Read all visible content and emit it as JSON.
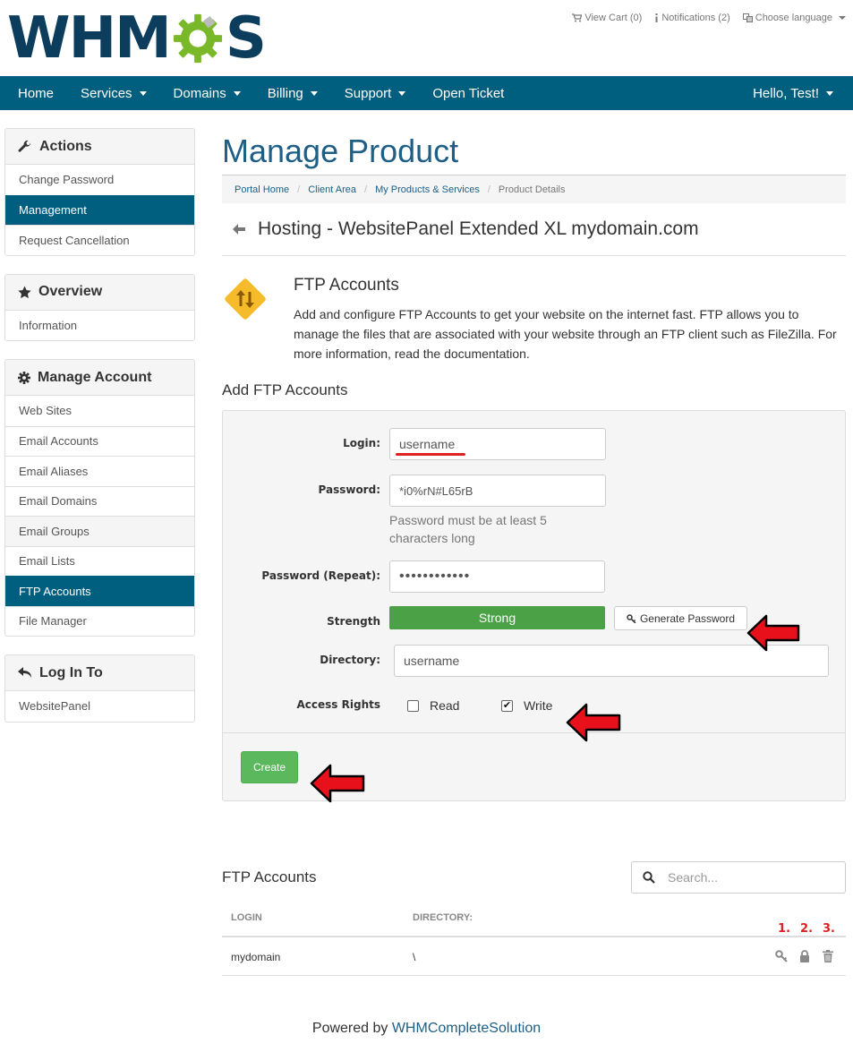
{
  "brand": {
    "logo_prefix": "WHM",
    "logo_suffix": "S"
  },
  "top_links": {
    "cart": "View Cart (0)",
    "notifications": "Notifications (2)",
    "language": "Choose language"
  },
  "nav": {
    "home": "Home",
    "services": "Services",
    "domains": "Domains",
    "billing": "Billing",
    "support": "Support",
    "open_ticket": "Open Ticket",
    "user": "Hello, Test!"
  },
  "sidebar": {
    "actions": {
      "title": "Actions",
      "items": [
        "Change Password",
        "Management",
        "Request Cancellation"
      ]
    },
    "overview": {
      "title": "Overview",
      "items": [
        "Information"
      ]
    },
    "manage": {
      "title": "Manage Account",
      "items": [
        "Web Sites",
        "Email Accounts",
        "Email Aliases",
        "Email Domains",
        "Email Groups",
        "Email Lists",
        "FTP Accounts",
        "File Manager"
      ]
    },
    "login": {
      "title": "Log In To",
      "items": [
        "WebsitePanel"
      ]
    }
  },
  "page": {
    "title": "Manage Product",
    "breadcrumb": [
      "Portal Home",
      "Client Area",
      "My Products & Services",
      "Product Details"
    ],
    "product": "Hosting - WebsitePanel Extended XL mydomain.com"
  },
  "intro": {
    "title": "FTP Accounts",
    "text": "Add and configure FTP Accounts to get your website on the internet fast. FTP allows you to manage the files that are associated with your website through an FTP client such as FileZilla. For more information, read the documentation."
  },
  "form": {
    "section_title": "Add FTP Accounts",
    "login_label": "Login:",
    "login_value": "username",
    "password_label": "Password:",
    "password_value": "*i0%rN#L65rB",
    "password_help": "Password must be at least 5 characters long",
    "repeat_label": "Password (Repeat):",
    "repeat_value": "••••••••••••",
    "strength_label": "Strength",
    "strength_value": "Strong",
    "generate_label": "Generate Password",
    "directory_label": "Directory:",
    "directory_value": "username",
    "rights_label": "Access Rights",
    "read_label": "Read",
    "read_checked": false,
    "write_label": "Write",
    "write_checked": true,
    "create_label": "Create"
  },
  "list": {
    "title": "FTP Accounts",
    "search_placeholder": "Search...",
    "col_login": "LOGIN",
    "col_directory": "DIRECTORY:",
    "markers": [
      "1.",
      "2.",
      "3."
    ],
    "rows": [
      {
        "login": "mydomain",
        "directory": "\\"
      }
    ]
  },
  "footer": {
    "prefix": "Powered by ",
    "link": "WHMCompleteSolution"
  },
  "colors": {
    "nav": "#005f7f",
    "title": "#1f5f86",
    "strength": "#4ba246",
    "create": "#5cb85c",
    "annotation": "#e02020"
  }
}
